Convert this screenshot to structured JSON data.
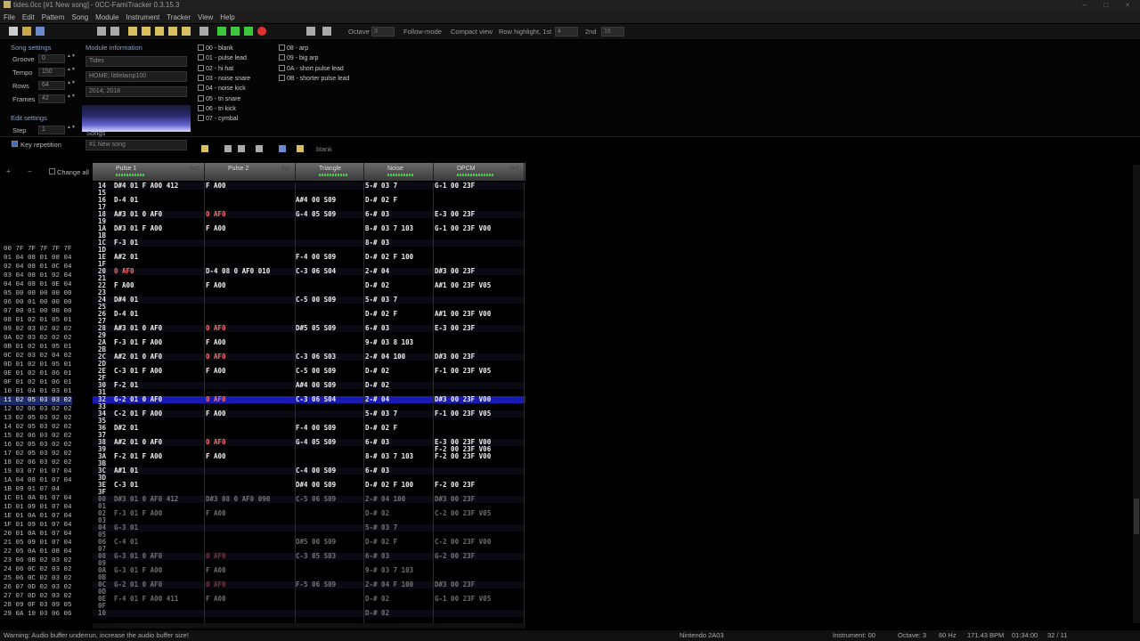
{
  "window": {
    "title": "tides.0cc [#1 New song] - 0CC-FamiTracker 0.3.15.3"
  },
  "menu": [
    "File",
    "Edit",
    "Pattern",
    "Song",
    "Module",
    "Instrument",
    "Tracker",
    "View",
    "Help"
  ],
  "toolbar": {
    "octave_label": "Octave",
    "octave_value": "3",
    "follow_mode": "Follow-mode",
    "compact_view": "Compact view",
    "row_highlight_label": "Row highlight, 1st",
    "row_highlight_1st": "4",
    "row_highlight_2nd_label": "2nd",
    "row_highlight_2nd": "16"
  },
  "song_settings": {
    "title": "Song settings",
    "groove_label": "Groove",
    "groove": "0",
    "tempo_label": "Tempo",
    "tempo": "150",
    "rows_label": "Rows",
    "rows": "64",
    "frames_label": "Frames",
    "frames": "42"
  },
  "edit_settings": {
    "title": "Edit settings",
    "step_label": "Step",
    "step": "1",
    "key_repetition": "Key repetition",
    "change_all": "Change all"
  },
  "module_info": {
    "title": "Module information",
    "name": "Tides",
    "artist": "HOME; littlelamp100",
    "copyright": "2014; 2018",
    "songs_label": "Songs",
    "song": "#1 New song"
  },
  "instruments": [
    "00 - blank",
    "01 - pulse lead",
    "02 - hi hat",
    "03 - noise snare",
    "04 - noise kick",
    "05 - tri snare",
    "06 - tri kick",
    "07 - cymbal",
    "08 - arp",
    "09 - big arp",
    "0A - short pulse lead",
    "0B - shorter pulse lead"
  ],
  "instrument_name": "blank",
  "channels": [
    {
      "name": "Pulse 1",
      "fx": "fx2",
      "vu": 0.55
    },
    {
      "name": "Pulse 2",
      "fx": "fx2",
      "vu": 0.0
    },
    {
      "name": "Triangle",
      "fx": "",
      "vu": 0.55
    },
    {
      "name": "Noise",
      "fx": "",
      "vu": 0.5
    },
    {
      "name": "DPCM",
      "fx": "fx2",
      "vu": 0.7
    }
  ],
  "frames": [
    "00 7F 7F 7F 7F 7F",
    "01 04 08 01 08 04",
    "02 04 08 01 0C 04",
    "03 04 08 01 02 04",
    "04 04 08 01 0E 04",
    "05 00 00 00 00 00",
    "06 00 01 00 00 00",
    "07 00 01 00 00 00",
    "08 01 02 01 05 01",
    "09 02 03 02 02 02",
    "0A 02 03 02 02 02",
    "0B 01 02 01 05 01",
    "0C 02 03 02 04 02",
    "0D 01 02 01 05 01",
    "0E 01 02 01 06 01",
    "0F 01 02 01 06 01",
    "10 01 04 01 03 01",
    "11 02 05 03 03 02",
    "12 02 06 03 02 02",
    "13 02 05 03 02 02",
    "14 02 05 03 02 02",
    "15 02 06 03 02 02",
    "16 02 05 03 02 02",
    "17 02 05 03 02 02",
    "18 02 06 03 02 02",
    "19 03 07 01 07 04",
    "1A 04 08 01 07 04",
    "1B 09 01 07 04",
    "1C 01 0A 01 07 04",
    "1D 01 09 01 07 04",
    "1E 01 0A 01 07 04",
    "1F 01 09 01 07 04",
    "20 01 0A 01 07 04",
    "21 05 09 01 07 04",
    "22 05 0A 01 08 04",
    "23 06 0B 02 03 02",
    "24 06 0C 02 03 02",
    "25 06 0C 02 03 02",
    "26 07 0D 02 03 02",
    "27 07 0D 02 03 02",
    "28 09 0F 03 09 05",
    "29 0A 10 03 06 06"
  ],
  "current_frame_index": 17,
  "pattern_rows": [
    {
      "r": "14",
      "c": [
        "D#4 01 F A00 412",
        "F A00",
        "",
        "5-# 03 7",
        "G-1 00 23F"
      ]
    },
    {
      "r": "15",
      "c": [
        "",
        "",
        "",
        "",
        ""
      ]
    },
    {
      "r": "16",
      "c": [
        "D-4 01",
        "",
        "A#4 00 S09",
        "D-# 02 F",
        ""
      ]
    },
    {
      "r": "17",
      "c": [
        "",
        "",
        "",
        "",
        ""
      ]
    },
    {
      "r": "18",
      "c": [
        "A#3 01 0 AF0",
        "0 AF0",
        "G-4 05 S09",
        "6-# 03",
        "E-3 00 23F"
      ]
    },
    {
      "r": "19",
      "c": [
        "",
        "",
        "",
        "",
        ""
      ]
    },
    {
      "r": "1A",
      "c": [
        "D#3 01 F A00",
        "F A00",
        "",
        "B-# 03 7 103",
        "G-1 00 23F V00"
      ]
    },
    {
      "r": "1B",
      "c": [
        "",
        "",
        "",
        "",
        ""
      ]
    },
    {
      "r": "1C",
      "c": [
        "F-3 01",
        "",
        "",
        "8-# 03",
        ""
      ]
    },
    {
      "r": "1D",
      "c": [
        "",
        "",
        "",
        "",
        ""
      ]
    },
    {
      "r": "1E",
      "c": [
        "A#2 01",
        "",
        "F-4 00 S09",
        "D-# 02 F 100",
        ""
      ]
    },
    {
      "r": "1F",
      "c": [
        "",
        "",
        "",
        "",
        ""
      ]
    },
    {
      "r": "20",
      "c": [
        "0 AF0",
        "D-4 08 0 AF0 010",
        "C-3 06 S04",
        "2-# 04",
        "D#3 00 23F"
      ]
    },
    {
      "r": "21",
      "c": [
        "",
        "",
        "",
        "",
        ""
      ]
    },
    {
      "r": "22",
      "c": [
        "F A00",
        "F A00",
        "",
        "D-# 02",
        "A#1 00 23F V05"
      ]
    },
    {
      "r": "23",
      "c": [
        "",
        "",
        "",
        "",
        ""
      ]
    },
    {
      "r": "24",
      "c": [
        "D#4 01",
        "",
        "C-5 00 S09",
        "5-# 03 7",
        ""
      ]
    },
    {
      "r": "25",
      "c": [
        "",
        "",
        "",
        "",
        ""
      ]
    },
    {
      "r": "26",
      "c": [
        "D-4 01",
        "",
        "",
        "D-# 02 F",
        "A#1 00 23F V00"
      ]
    },
    {
      "r": "27",
      "c": [
        "",
        "",
        "",
        "",
        ""
      ]
    },
    {
      "r": "28",
      "c": [
        "A#3 01 0 AF0",
        "0 AF0",
        "D#5 05 S09",
        "6-# 03",
        "E-3 00 23F"
      ]
    },
    {
      "r": "29",
      "c": [
        "",
        "",
        "",
        "",
        ""
      ]
    },
    {
      "r": "2A",
      "c": [
        "F-3 01 F A00",
        "F A00",
        "",
        "9-# 03 8 103",
        ""
      ]
    },
    {
      "r": "2B",
      "c": [
        "",
        "",
        "",
        "",
        ""
      ]
    },
    {
      "r": "2C",
      "c": [
        "A#2 01 0 AF0",
        "0 AF0",
        "C-3 06 S03",
        "2-# 04 100",
        "D#3 00 23F"
      ]
    },
    {
      "r": "2D",
      "c": [
        "",
        "",
        "",
        "",
        ""
      ]
    },
    {
      "r": "2E",
      "c": [
        "C-3 01 F A00",
        "F A00",
        "C-5 00 S09",
        "D-# 02",
        "F-1 00 23F V05"
      ]
    },
    {
      "r": "2F",
      "c": [
        "",
        "",
        "",
        "",
        ""
      ]
    },
    {
      "r": "30",
      "c": [
        "F-2 01",
        "",
        "A#4 00 S09",
        "D-# 02",
        ""
      ]
    },
    {
      "r": "31",
      "c": [
        "",
        "",
        "",
        "",
        ""
      ]
    },
    {
      "r": "32",
      "c": [
        "G-2 01 0 AF0",
        "0 AF0",
        "C-3 06 S04",
        "2-# 04",
        "D#3 00 23F V00"
      ]
    },
    {
      "r": "33",
      "c": [
        "",
        "",
        "",
        "",
        ""
      ]
    },
    {
      "r": "34",
      "c": [
        "C-2 01 F A00",
        "F A00",
        "",
        "5-# 03 7",
        "F-1 00 23F V05"
      ]
    },
    {
      "r": "35",
      "c": [
        "",
        "",
        "",
        "",
        ""
      ]
    },
    {
      "r": "36",
      "c": [
        "D#2 01",
        "",
        "F-4 00 S09",
        "D-# 02 F",
        ""
      ]
    },
    {
      "r": "37",
      "c": [
        "",
        "",
        "",
        "",
        ""
      ]
    },
    {
      "r": "38",
      "c": [
        "A#2 01 0 AF0",
        "0 AF0",
        "G-4 05 S09",
        "6-# 03",
        "E-3 00 23F V00"
      ]
    },
    {
      "r": "39",
      "c": [
        "",
        "",
        "",
        "",
        "F-2 00 23F V06"
      ]
    },
    {
      "r": "3A",
      "c": [
        "F-2 01 F A00",
        "F A00",
        "",
        "8-# 03 7 103",
        "F-2 00 23F V00"
      ]
    },
    {
      "r": "3B",
      "c": [
        "",
        "",
        "",
        "",
        ""
      ]
    },
    {
      "r": "3C",
      "c": [
        "A#1 01",
        "",
        "C-4 00 S09",
        "6-# 03",
        ""
      ]
    },
    {
      "r": "3D",
      "c": [
        "",
        "",
        "",
        "",
        ""
      ]
    },
    {
      "r": "3E",
      "c": [
        "C-3 01",
        "",
        "D#4 00 S09",
        "D-# 02 F 100",
        "F-2 00 23F"
      ]
    },
    {
      "r": "3F",
      "c": [
        "",
        "",
        "",
        "",
        ""
      ]
    },
    {
      "r": "00",
      "c": [
        "D#3 01 0 AF0 412",
        "D#3 08 0 AF0 090",
        "C-5 06 S09",
        "2-# 04 100",
        "D#3 00 23F"
      ],
      "dim": true
    },
    {
      "r": "01",
      "c": [
        "",
        "",
        "",
        "",
        ""
      ],
      "dim": true
    },
    {
      "r": "02",
      "c": [
        "F-3 01 F A00",
        "F A00",
        "",
        "D-# 02",
        "C-2 00 23F V05"
      ],
      "dim": true
    },
    {
      "r": "03",
      "c": [
        "",
        "",
        "",
        "",
        ""
      ],
      "dim": true
    },
    {
      "r": "04",
      "c": [
        "G-3 01",
        "",
        "",
        "5-# 03 7",
        ""
      ],
      "dim": true
    },
    {
      "r": "05",
      "c": [
        "",
        "",
        "",
        "",
        ""
      ],
      "dim": true
    },
    {
      "r": "06",
      "c": [
        "C-4 01",
        "",
        "D#5 00 S09",
        "D-# 02 F",
        "C-2 00 23F V00"
      ],
      "dim": true
    },
    {
      "r": "07",
      "c": [
        "",
        "",
        "",
        "",
        ""
      ],
      "dim": true
    },
    {
      "r": "08",
      "c": [
        "G-3 01 0 AF0",
        "0 AF0",
        "C-3 05 S03",
        "6-# 03",
        "G-2 00 23F"
      ],
      "dim": true
    },
    {
      "r": "09",
      "c": [
        "",
        "",
        "",
        "",
        ""
      ],
      "dim": true
    },
    {
      "r": "0A",
      "c": [
        "G-3 01 F A00",
        "F A00",
        "",
        "9-# 03 7 103",
        ""
      ],
      "dim": true
    },
    {
      "r": "0B",
      "c": [
        "",
        "",
        "",
        "",
        ""
      ],
      "dim": true
    },
    {
      "r": "0C",
      "c": [
        "G-2 01 0 AF0",
        "0 AF0",
        "F-5 06 S09",
        "2-# 04 F 100",
        "D#3 00 23F"
      ],
      "dim": true
    },
    {
      "r": "0D",
      "c": [
        "",
        "",
        "",
        "",
        ""
      ],
      "dim": true
    },
    {
      "r": "0E",
      "c": [
        "F-4 01 F A00 411",
        "F A00",
        "",
        "D-# 02",
        "G-1 00 23F V05"
      ],
      "dim": true
    },
    {
      "r": "0F",
      "c": [
        "",
        "",
        "",
        "",
        ""
      ],
      "dim": true
    },
    {
      "r": "10",
      "c": [
        "",
        "",
        "",
        "D-# 02",
        ""
      ],
      "dim": true
    }
  ],
  "current_row": "32",
  "status": {
    "message": "Warning: Audio buffer underrun, increase the audio buffer size!",
    "chip": "Nintendo 2A03",
    "instrument": "Instrument: 00",
    "octave": "Octave: 3",
    "rate": "60 Hz",
    "bpm": "171.43 BPM",
    "time": "01:34:00",
    "position": "32 / 11"
  },
  "colors": {
    "note": "#f0f0f0",
    "instrument": "#86ff86",
    "volume": "#8080ff",
    "effect": "#ff6b6b",
    "highlight_row": "#1a1ab4",
    "frame_current": "#1b2a66"
  }
}
